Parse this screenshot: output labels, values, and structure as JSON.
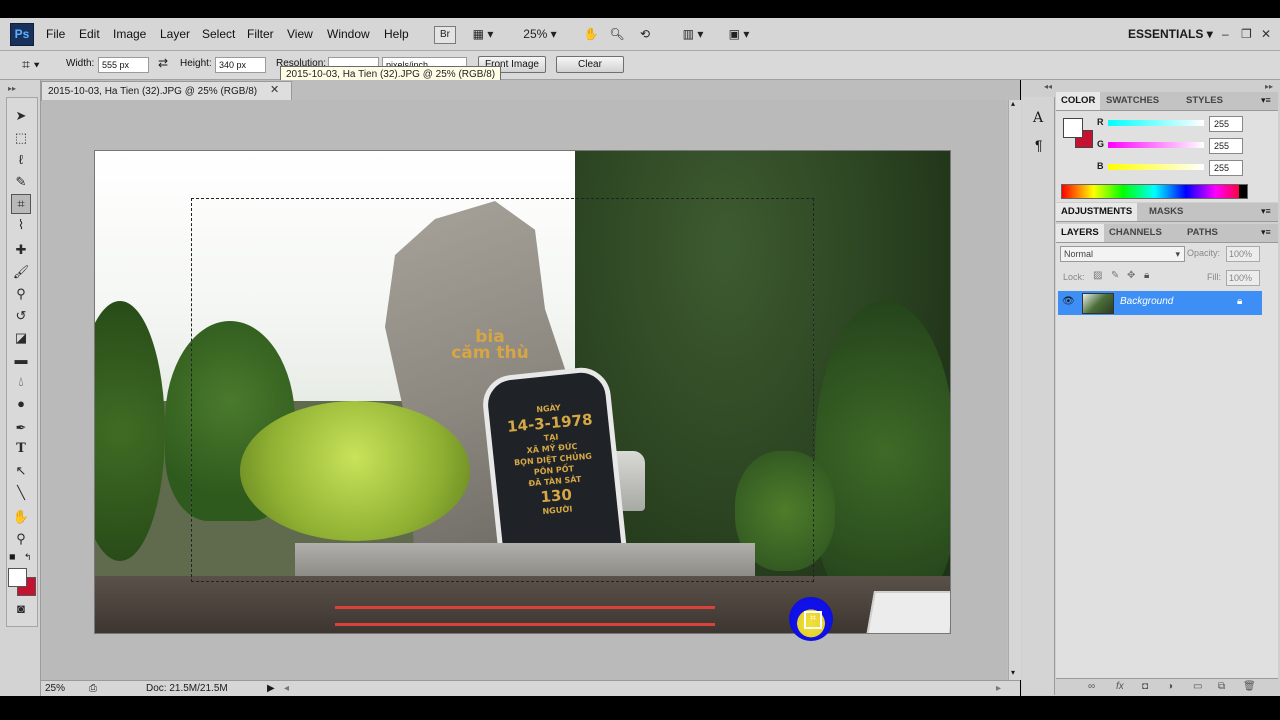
{
  "menu": {
    "items": [
      "File",
      "Edit",
      "Image",
      "Layer",
      "Select",
      "Filter",
      "View",
      "Window",
      "Help"
    ],
    "bridge": "Br",
    "zoom": "25%",
    "workspace": "ESSENTIALS"
  },
  "options": {
    "width_label": "Width:",
    "width_value": "555 px",
    "height_label": "Height:",
    "height_value": "340 px",
    "resolution_label": "Resolution:",
    "resolution_unit": "pixels/inch",
    "front_image": "Front Image",
    "clear": "Clear"
  },
  "tooltip": "2015-10-03, Ha Tien (32).JPG @ 25% (RGB/8)",
  "document": {
    "tab_title": "2015-10-03, Ha Tien (32).JPG @ 25% (RGB/8)",
    "photo_text_fist": "bia\ncăm thù",
    "plaque": {
      "line1": "NGÀY",
      "date": "14-3-1978",
      "line3": "TẠI",
      "line4": "XÃ MỸ ĐỨC",
      "line5": "BỌN DIỆT CHỦNG",
      "line6": "PÔN PỐT",
      "line7": "ĐÃ TÀN SÁT",
      "count": "130",
      "line9": "NGƯỜI"
    }
  },
  "status": {
    "zoom": "25%",
    "doc": "Doc: 21.5M/21.5M"
  },
  "color_panel": {
    "tabs": [
      "COLOR",
      "SWATCHES",
      "STYLES"
    ],
    "channels": [
      {
        "name": "R",
        "value": "255",
        "gradient": "linear-gradient(90deg,#00ffff,#ffffff)"
      },
      {
        "name": "G",
        "value": "255",
        "gradient": "linear-gradient(90deg,#ff00ff,#ffffff)"
      },
      {
        "name": "B",
        "value": "255",
        "gradient": "linear-gradient(90deg,#ffff00,#ffffff)"
      }
    ],
    "foreground": "#ffffff",
    "background": "#c41230"
  },
  "adjustments_panel": {
    "tabs": [
      "ADJUSTMENTS",
      "MASKS"
    ]
  },
  "layers_panel": {
    "tabs": [
      "LAYERS",
      "CHANNELS",
      "PATHS"
    ],
    "blend_mode": "Normal",
    "opacity_label": "Opacity:",
    "opacity": "100%",
    "lock_label": "Lock:",
    "fill_label": "Fill:",
    "fill": "100%",
    "layer_name": "Background"
  }
}
